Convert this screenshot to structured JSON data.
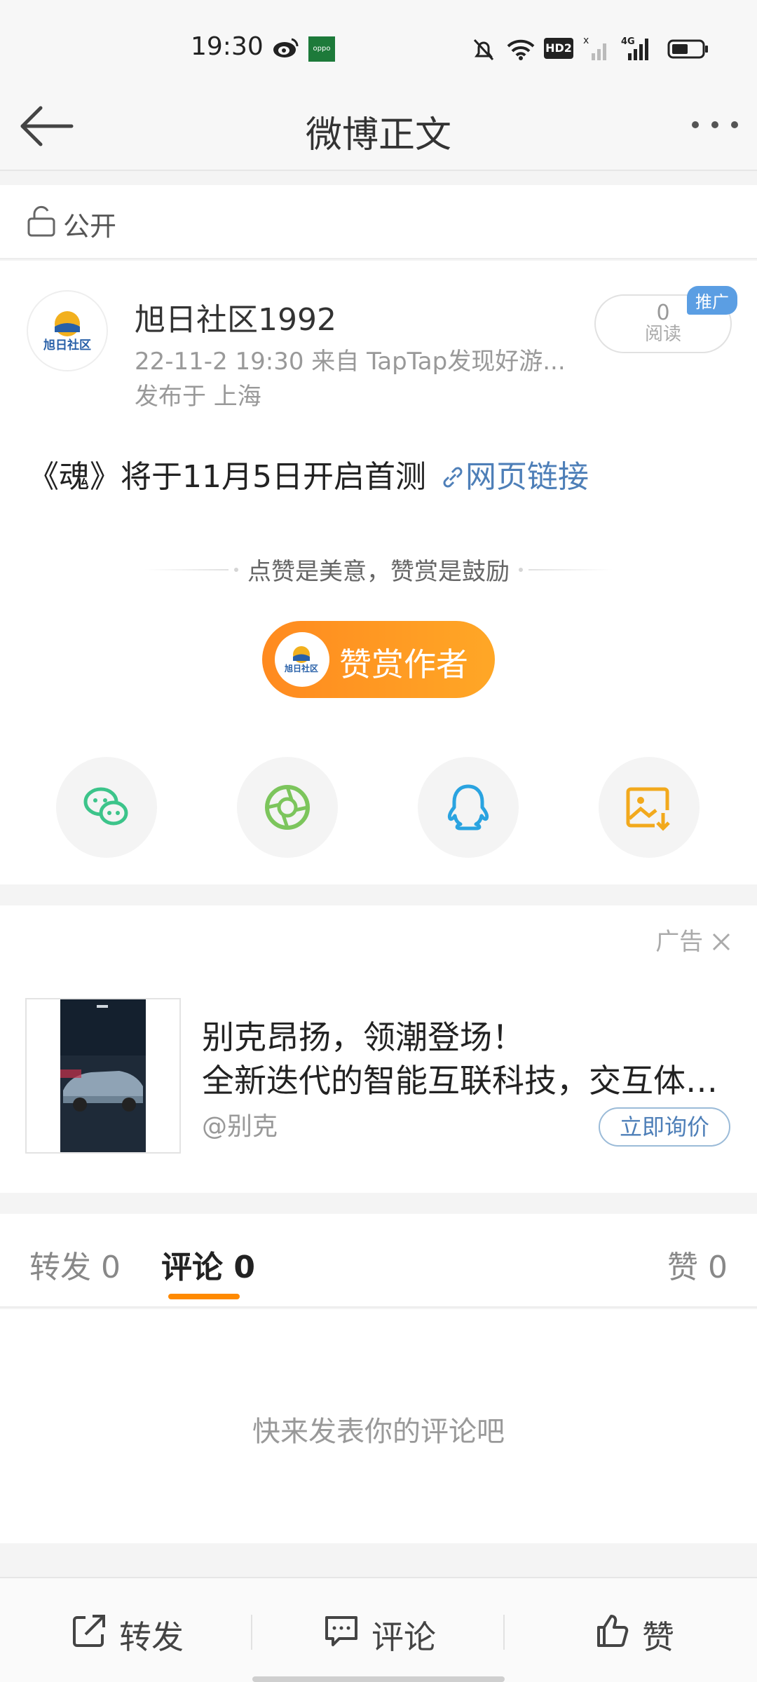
{
  "status_bar": {
    "time": "19:30",
    "icons": [
      "weibo-icon",
      "oppo-icon",
      "bell-off-icon",
      "wifi-icon",
      "hd2-icon",
      "signal-empty-icon",
      "signal-4g-icon",
      "battery-icon"
    ],
    "hd_label": "HD2",
    "network_label": "4G",
    "oppo_label": "oppo"
  },
  "nav": {
    "title": "微博正文"
  },
  "visibility": {
    "label": "公开"
  },
  "post": {
    "author": "旭日社区1992",
    "avatar_text": "旭日社区",
    "meta": "22-11-2 19:30   来自 TapTap发现好游...",
    "location": "发布于 上海",
    "read_count": "0",
    "read_label": "阅读",
    "promo_badge": "推广",
    "text": "《魂》将于11月5日开启首测 ",
    "link_text": "网页链接",
    "reward_tip": "点赞是美意，赞赏是鼓励",
    "reward_button": "赞赏作者"
  },
  "share_targets": [
    "wechat-icon",
    "moments-icon",
    "qq-icon",
    "save-image-icon"
  ],
  "ad": {
    "tag": "广告",
    "headline": "别克昂扬，领潮登场！",
    "body": "全新迭代的智能互联科技，交互体验焕然一新",
    "account": "@别克",
    "cta": "立即询价"
  },
  "tabs": [
    {
      "label": "转发 0"
    },
    {
      "label": "评论 0"
    },
    {
      "label": "赞 0"
    }
  ],
  "active_tab": "评论 0",
  "comments": {
    "empty_text": "快来发表你的评论吧"
  },
  "bottom_bar": {
    "repost": "转发",
    "comment": "评论",
    "like": "赞"
  },
  "colors": {
    "accent": "#ff8a00",
    "link": "#4e7fb8",
    "promo": "#5b9ee3"
  }
}
